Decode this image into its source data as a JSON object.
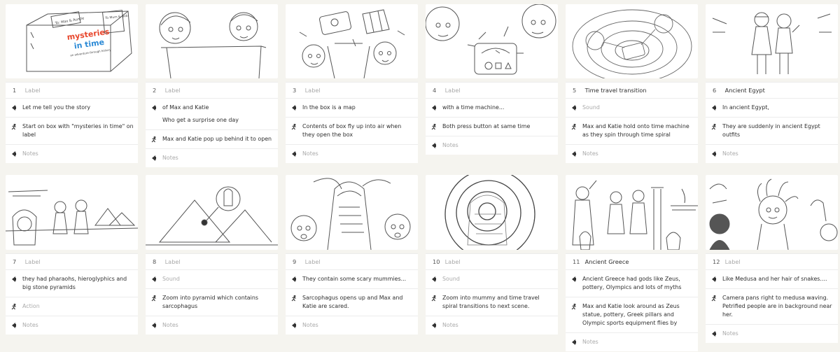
{
  "frames": [
    {
      "number": "1",
      "title": "Label",
      "title_placeholder": true,
      "lines": [
        {
          "icon": "speaker-icon",
          "text": "Let me tell you the story",
          "placeholder": false
        },
        {
          "icon": "action-icon",
          "text": "Start on box with \"mysteries in time\" on label",
          "placeholder": false
        },
        {
          "icon": "speaker-icon",
          "text": "Notes",
          "placeholder": true
        }
      ],
      "sketch_text": {
        "tag": "To: Max & Auntie",
        "logo1": "mysteries",
        "logo2": "in time",
        "sub": "an adventure through history",
        "note": "To Mum & Bob"
      }
    },
    {
      "number": "2",
      "title": "Label",
      "title_placeholder": true,
      "lines": [
        {
          "icon": "speaker-icon",
          "text": "of Max and Katie",
          "text2": "Who get a surprise one day",
          "placeholder": false
        },
        {
          "icon": "action-icon",
          "text": "Max and Katie pop up behind it to open",
          "placeholder": false
        },
        {
          "icon": "speaker-icon",
          "text": "Notes",
          "placeholder": true
        }
      ]
    },
    {
      "number": "3",
      "title": "Label",
      "title_placeholder": true,
      "lines": [
        {
          "icon": "speaker-icon",
          "text": "In the box is a map",
          "placeholder": false
        },
        {
          "icon": "action-icon",
          "text": "Contents of box fly up into air when they open the box",
          "placeholder": false
        },
        {
          "icon": "speaker-icon",
          "text": "Notes",
          "placeholder": true
        }
      ]
    },
    {
      "number": "4",
      "title": "Label",
      "title_placeholder": true,
      "lines": [
        {
          "icon": "speaker-icon",
          "text": "with a time machine...",
          "placeholder": false
        },
        {
          "icon": "action-icon",
          "text": "Both press button at same time",
          "placeholder": false
        },
        {
          "icon": "speaker-icon",
          "text": "Notes",
          "placeholder": true
        }
      ]
    },
    {
      "number": "5",
      "title": "Time travel transition",
      "title_placeholder": false,
      "lines": [
        {
          "icon": "speaker-icon",
          "text": "Sound",
          "placeholder": true
        },
        {
          "icon": "action-icon",
          "text": "Max and Katie hold onto time machine as they spin through time spiral",
          "placeholder": false
        },
        {
          "icon": "speaker-icon",
          "text": "Notes",
          "placeholder": true
        }
      ]
    },
    {
      "number": "6",
      "title": "Ancient Egypt",
      "title_placeholder": false,
      "lines": [
        {
          "icon": "speaker-icon",
          "text": "In ancient Egypt,",
          "placeholder": false
        },
        {
          "icon": "action-icon",
          "text": "They are suddenly in ancient Egypt outfits",
          "placeholder": false
        },
        {
          "icon": "speaker-icon",
          "text": "Notes",
          "placeholder": true
        }
      ]
    },
    {
      "number": "7",
      "title": "Label",
      "title_placeholder": true,
      "lines": [
        {
          "icon": "speaker-icon",
          "text": "they had pharaohs, hieroglyphics and big stone pyramids",
          "placeholder": false
        },
        {
          "icon": "action-icon",
          "text": "Action",
          "placeholder": true
        },
        {
          "icon": "speaker-icon",
          "text": "Notes",
          "placeholder": true
        }
      ]
    },
    {
      "number": "8",
      "title": "Label",
      "title_placeholder": true,
      "lines": [
        {
          "icon": "speaker-icon",
          "text": "Sound",
          "placeholder": true
        },
        {
          "icon": "action-icon",
          "text": "Zoom into pyramid which contains sarcophagus",
          "placeholder": false
        },
        {
          "icon": "speaker-icon",
          "text": "Notes",
          "placeholder": true
        }
      ]
    },
    {
      "number": "9",
      "title": "Label",
      "title_placeholder": true,
      "lines": [
        {
          "icon": "speaker-icon",
          "text": "They contain some scary mummies...",
          "placeholder": false
        },
        {
          "icon": "action-icon",
          "text": "Sarcophagus opens up and Max and Katie are scared.",
          "placeholder": false
        },
        {
          "icon": "speaker-icon",
          "text": "Notes",
          "placeholder": true
        }
      ]
    },
    {
      "number": "10",
      "title": "Label",
      "title_placeholder": true,
      "lines": [
        {
          "icon": "speaker-icon",
          "text": "Sound",
          "placeholder": true
        },
        {
          "icon": "action-icon",
          "text": "Zoom into mummy and time travel spiral transitions to next scene.",
          "placeholder": false
        },
        {
          "icon": "speaker-icon",
          "text": "Notes",
          "placeholder": true
        }
      ]
    },
    {
      "number": "11",
      "title": "Ancient Greece",
      "title_placeholder": false,
      "lines": [
        {
          "icon": "speaker-icon",
          "text": "Ancient Greece had gods like Zeus, pottery, Olympics and lots of myths",
          "placeholder": false
        },
        {
          "icon": "action-icon",
          "text": "Max and Katie look around as Zeus statue, pottery, Greek pillars and Olympic sports equipment flies by",
          "placeholder": false
        },
        {
          "icon": "speaker-icon",
          "text": "Notes",
          "placeholder": true
        }
      ]
    },
    {
      "number": "12",
      "title": "Label",
      "title_placeholder": true,
      "lines": [
        {
          "icon": "speaker-icon",
          "text": "Like Medusa and her hair of snakes....",
          "placeholder": false
        },
        {
          "icon": "action-icon",
          "text": "Camera pans right to medusa waving. Petrified people are in background near her.",
          "placeholder": false
        },
        {
          "icon": "speaker-icon",
          "text": "Notes",
          "placeholder": true
        }
      ]
    }
  ],
  "colors": {
    "background": "#f5f4ef",
    "card": "#ffffff",
    "placeholder_text": "#aaaaaa",
    "text": "#2e2e2e",
    "sketch": "#5a5a5a"
  }
}
